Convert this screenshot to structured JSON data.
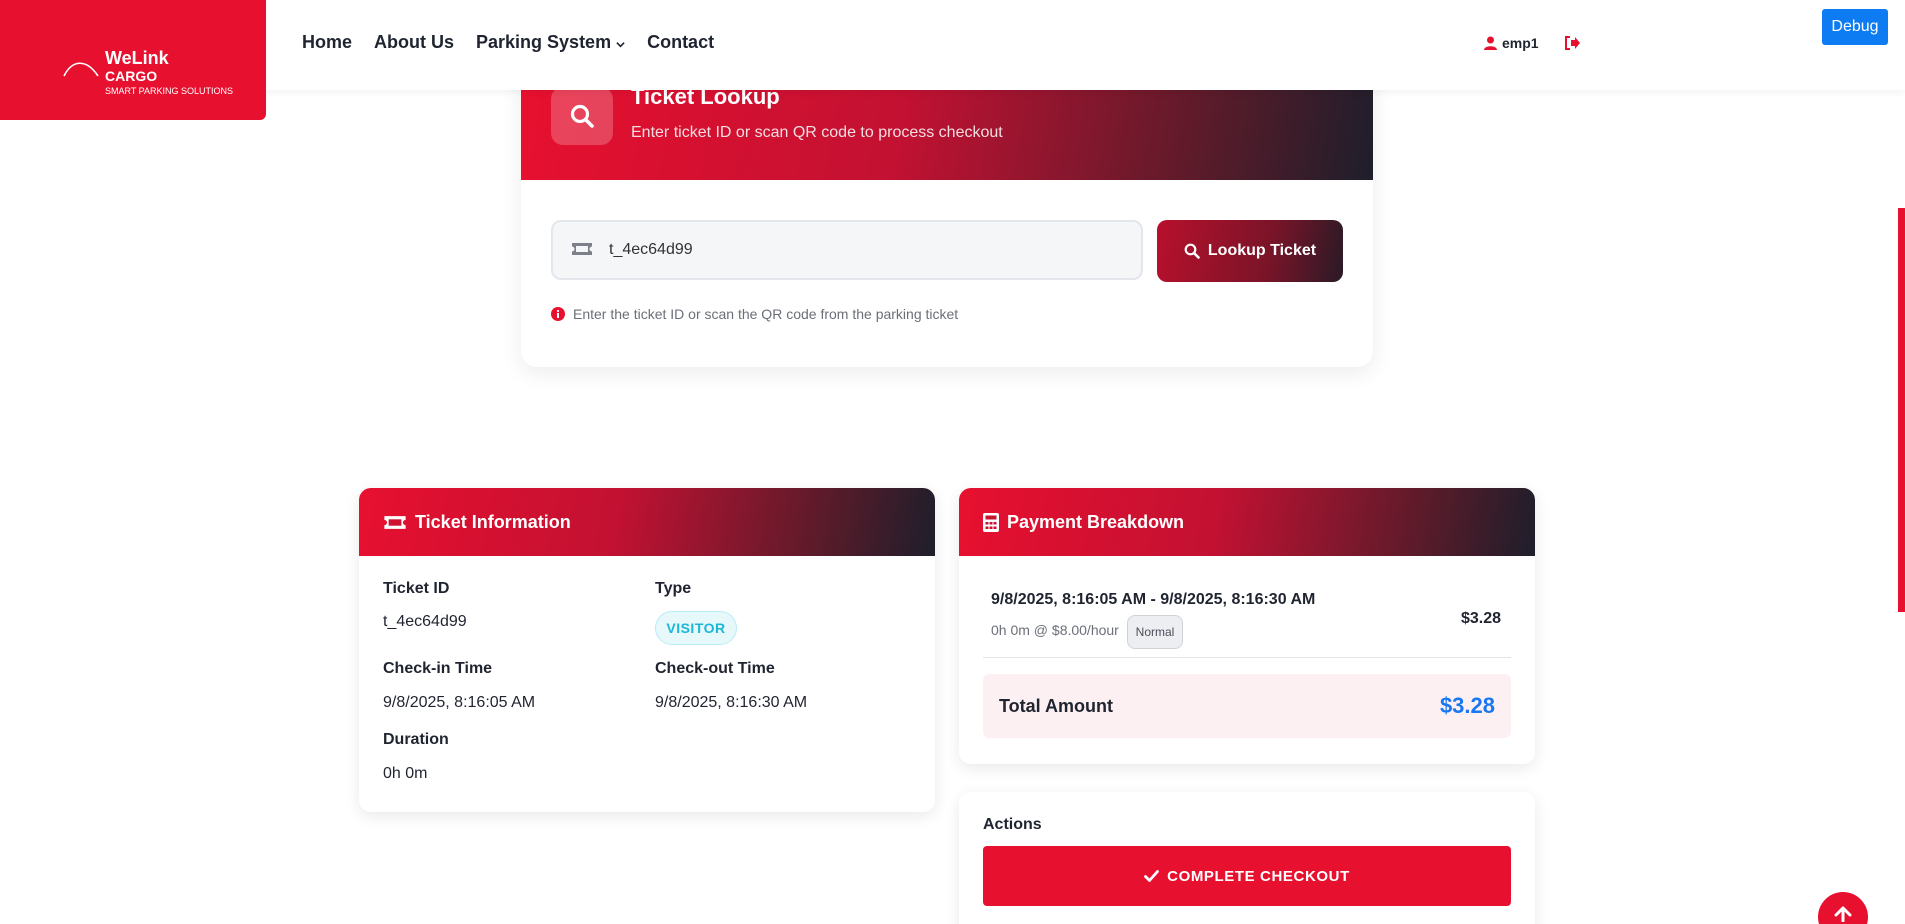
{
  "header": {
    "logo": {
      "line1": "WeLink",
      "line2": "CARGO",
      "tagline": "SMART PARKING SOLUTIONS"
    },
    "nav": [
      {
        "label": "Home"
      },
      {
        "label": "About Us"
      },
      {
        "label": "Parking System",
        "has_dropdown": true
      },
      {
        "label": "Contact"
      }
    ],
    "user": {
      "name": "emp1",
      "icon": "user-icon"
    },
    "logout_icon": "sign-out-icon",
    "debug_label": "Debug"
  },
  "lookup": {
    "title": "Ticket Lookup",
    "subtitle": "Enter ticket ID or scan QR code to process checkout",
    "input_value": "t_4ec64d99",
    "button_label": "Lookup Ticket",
    "help_text": "Enter the ticket ID or scan the QR code from the parking ticket"
  },
  "ticket_info": {
    "title": "Ticket Information",
    "ticket_id_label": "Ticket ID",
    "ticket_id": "t_4ec64d99",
    "type_label": "Type",
    "type": "VISITOR",
    "checkin_label": "Check-in Time",
    "checkin": "9/8/2025, 8:16:05 AM",
    "checkout_label": "Check-out Time",
    "checkout": "9/8/2025, 8:16:30 AM",
    "duration_label": "Duration",
    "duration": "0h 0m"
  },
  "payment": {
    "title": "Payment Breakdown",
    "range": "9/8/2025, 8:16:05 AM - 9/8/2025, 8:16:30 AM",
    "rate": "0h 0m @ $8.00/hour",
    "rate_badge": "Normal",
    "amount": "$3.28",
    "total_label": "Total Amount",
    "total_value": "$3.28"
  },
  "actions": {
    "title": "Actions",
    "checkout_label": "COMPLETE CHECKOUT"
  },
  "colors": {
    "brand_red": "#e8102f",
    "dark": "#1e1e2b",
    "total_blue": "#1877f2",
    "debug_blue": "#0d7cf2",
    "visitor_cyan": "#1ab8d6"
  }
}
